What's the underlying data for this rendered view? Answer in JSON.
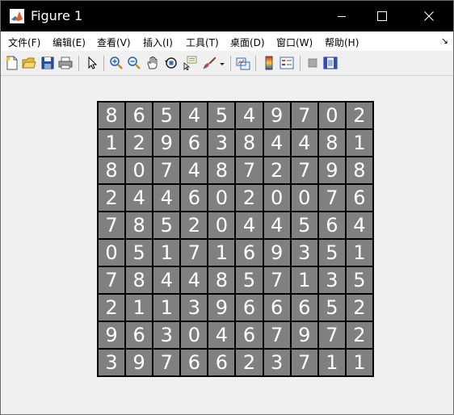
{
  "window": {
    "title": "Figure 1",
    "title_bar_color": "#000000",
    "controls": [
      "minimize-icon",
      "maximize-icon",
      "close-icon"
    ]
  },
  "menu": {
    "items": [
      "文件(F)",
      "编辑(E)",
      "查看(V)",
      "插入(I)",
      "工具(T)",
      "桌面(D)",
      "窗口(W)",
      "帮助(H)"
    ],
    "overflow_glyph": "↘"
  },
  "toolbar": {
    "buttons": [
      "new-figure-icon",
      "open-file-icon",
      "save-icon",
      "print-icon",
      "edit-plot-icon",
      "zoom-in-icon",
      "zoom-out-icon",
      "pan-icon",
      "rotate-3d-icon",
      "data-cursor-icon",
      "brush-icon",
      "brush-dropdown-icon",
      "link-plot-icon",
      "insert-colorbar-icon",
      "insert-legend-icon",
      "hide-plot-tools-icon",
      "show-plot-tools-icon"
    ]
  },
  "figure": {
    "cell_background": "#808080",
    "digit_color": "#ffffff",
    "border_color": "#000000",
    "digits": [
      [
        "8",
        "6",
        "5",
        "4",
        "5",
        "4",
        "9",
        "7",
        "0",
        "2"
      ],
      [
        "1",
        "2",
        "9",
        "6",
        "3",
        "8",
        "4",
        "4",
        "8",
        "1"
      ],
      [
        "8",
        "0",
        "7",
        "4",
        "8",
        "7",
        "2",
        "7",
        "9",
        "8"
      ],
      [
        "2",
        "4",
        "4",
        "6",
        "0",
        "2",
        "0",
        "0",
        "7",
        "6"
      ],
      [
        "7",
        "8",
        "5",
        "2",
        "0",
        "4",
        "4",
        "5",
        "6",
        "4"
      ],
      [
        "0",
        "5",
        "1",
        "7",
        "1",
        "6",
        "9",
        "3",
        "5",
        "1"
      ],
      [
        "7",
        "8",
        "4",
        "4",
        "8",
        "5",
        "7",
        "1",
        "3",
        "5"
      ],
      [
        "2",
        "1",
        "1",
        "3",
        "9",
        "6",
        "6",
        "6",
        "5",
        "2"
      ],
      [
        "9",
        "6",
        "3",
        "0",
        "4",
        "6",
        "7",
        "9",
        "7",
        "2"
      ],
      [
        "3",
        "9",
        "7",
        "6",
        "6",
        "2",
        "3",
        "7",
        "1",
        "1"
      ]
    ]
  }
}
